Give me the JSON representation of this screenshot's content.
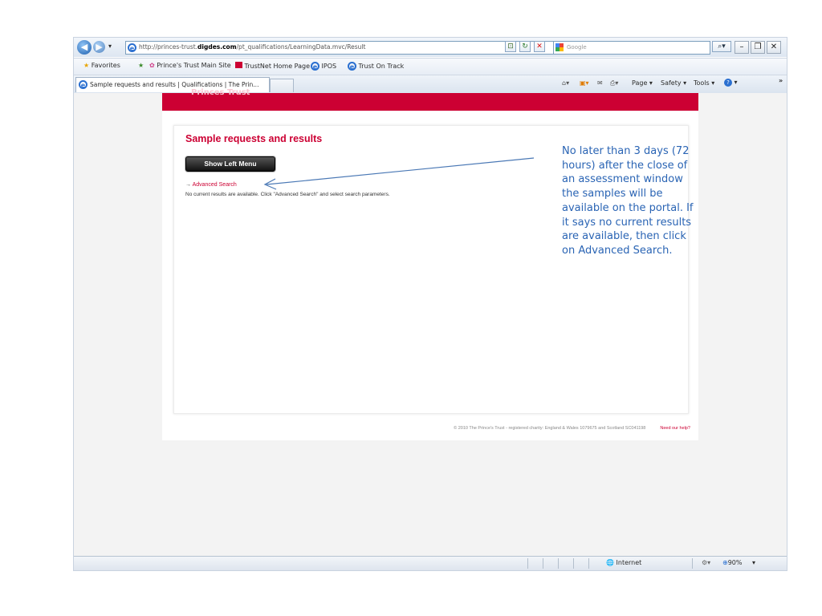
{
  "browser": {
    "address_prefix": "http://princes-trust.",
    "address_domain": "digdes.com",
    "address_path": "/pt_qualifications/LearningData.mvc/Result",
    "search_placeholder": "Google",
    "favorites_label": "Favorites",
    "favorites": [
      {
        "label": "Prince's Trust Main Site",
        "icon": "flower-icon"
      },
      {
        "label": "TrustNet Home Page",
        "icon": "trustnet-icon"
      },
      {
        "label": "IPOS",
        "icon": "ie-icon"
      },
      {
        "label": "Trust On Track",
        "icon": "ie-icon"
      }
    ],
    "tab_title": "Sample requests and results | Qualifications | The Prin...",
    "command_bar": {
      "page": "Page",
      "safety": "Safety",
      "tools": "Tools"
    },
    "status": {
      "zone": "Internet",
      "zoom": "90%"
    }
  },
  "page": {
    "header_clipped_text": "Princes Trust",
    "title": "Sample requests and results",
    "show_left_menu": "Show Left Menu",
    "advanced_search_arrow": "→",
    "advanced_search": "Advanced Search",
    "no_results": "No current results are available. Click \"Advanced Search\" and select search parameters.",
    "footer_text": "© 2010 The Prince's Trust - registered charity: England & Wales 1079675 and Scotland SC041198",
    "footer_help": "Need our help?"
  },
  "annotation": {
    "text": "No later than 3 days (72 hours) after the close of an assessment window the samples will be available on the portal. If it says no current results are available, then click on Advanced Search.",
    "color": "#2a64b4"
  },
  "colors": {
    "brand_red": "#cc0033"
  }
}
